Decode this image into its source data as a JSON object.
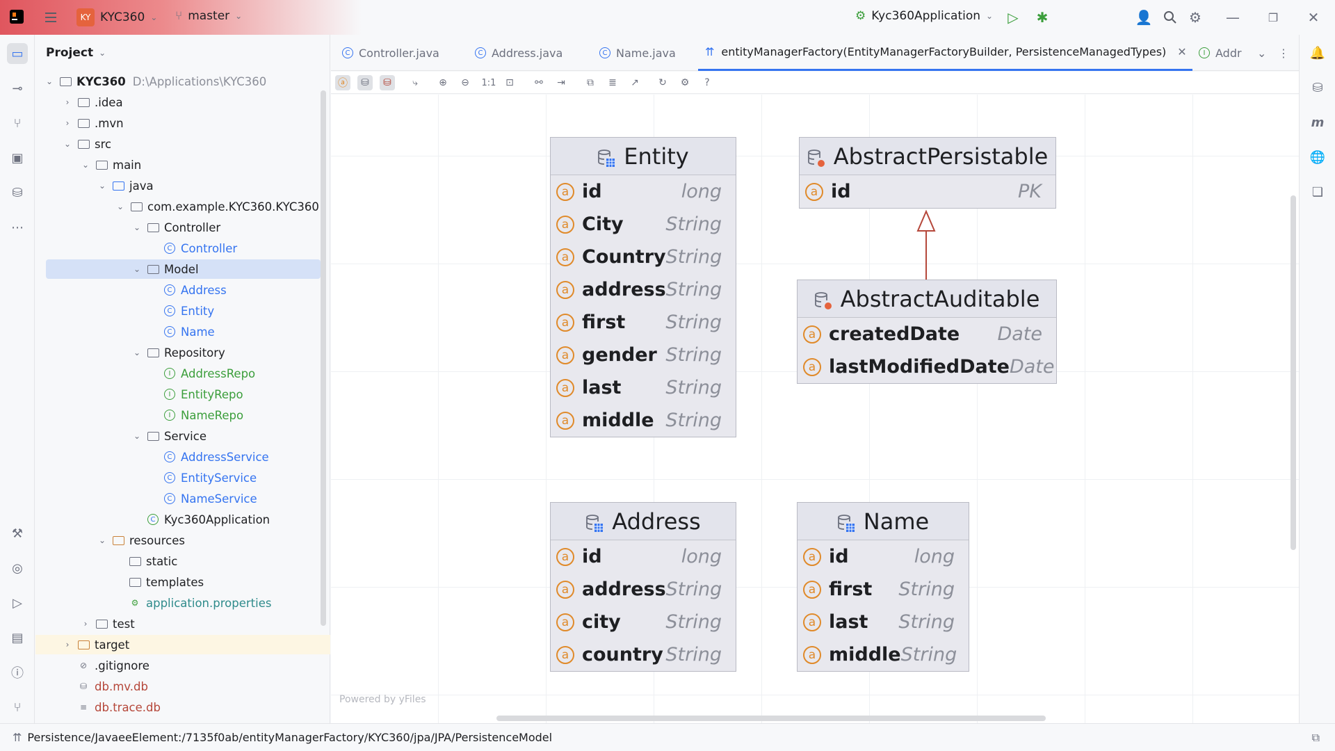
{
  "titlebar": {
    "project_badge": "KY",
    "project_name": "KYC360",
    "branch": "master",
    "run_config": "Kyc360Application"
  },
  "project_panel": {
    "title": "Project",
    "root_name": "KYC360",
    "root_path": "D:\\Applications\\KYC360",
    "items": [
      {
        "label": "KYC360"
      },
      {
        "label": ".idea"
      },
      {
        "label": ".mvn"
      },
      {
        "label": "src"
      },
      {
        "label": "main"
      },
      {
        "label": "java"
      },
      {
        "label": "com.example.KYC360.KYC360"
      },
      {
        "label": "Controller"
      },
      {
        "label": "Controller"
      },
      {
        "label": "Model"
      },
      {
        "label": "Address"
      },
      {
        "label": "Entity"
      },
      {
        "label": "Name"
      },
      {
        "label": "Repository"
      },
      {
        "label": "AddressRepo"
      },
      {
        "label": "EntityRepo"
      },
      {
        "label": "NameRepo"
      },
      {
        "label": "Service"
      },
      {
        "label": "AddressService"
      },
      {
        "label": "EntityService"
      },
      {
        "label": "NameService"
      },
      {
        "label": "Kyc360Application"
      },
      {
        "label": "resources"
      },
      {
        "label": "static"
      },
      {
        "label": "templates"
      },
      {
        "label": "application.properties"
      },
      {
        "label": "test"
      },
      {
        "label": "target"
      },
      {
        "label": ".gitignore"
      },
      {
        "label": "db.mv.db"
      },
      {
        "label": "db.trace.db"
      }
    ]
  },
  "tabs": [
    {
      "label": "Controller.java"
    },
    {
      "label": "Address.java"
    },
    {
      "label": "Name.java"
    },
    {
      "label": "entityManagerFactory(EntityManagerFactoryBuilder, PersistenceManagedTypes)"
    },
    {
      "label": "Addr"
    }
  ],
  "toolbar": {
    "actual_size": "1:1",
    "help": "?"
  },
  "diagram": {
    "nodes": [
      {
        "name": "Entity",
        "attrs": [
          {
            "name": "id",
            "type": "long"
          },
          {
            "name": "City",
            "type": "String"
          },
          {
            "name": "Country",
            "type": "String"
          },
          {
            "name": "address",
            "type": "String"
          },
          {
            "name": "first",
            "type": "String"
          },
          {
            "name": "gender",
            "type": "String"
          },
          {
            "name": "last",
            "type": "String"
          },
          {
            "name": "middle",
            "type": "String"
          }
        ]
      },
      {
        "name": "AbstractPersistable",
        "attrs": [
          {
            "name": "id",
            "type": "PK"
          }
        ]
      },
      {
        "name": "AbstractAuditable",
        "attrs": [
          {
            "name": "createdDate",
            "type": "Date"
          },
          {
            "name": "lastModifiedDate",
            "type": "Date"
          }
        ]
      },
      {
        "name": "Address",
        "attrs": [
          {
            "name": "id",
            "type": "long"
          },
          {
            "name": "address",
            "type": "String"
          },
          {
            "name": "city",
            "type": "String"
          },
          {
            "name": "country",
            "type": "String"
          }
        ]
      },
      {
        "name": "Name",
        "attrs": [
          {
            "name": "id",
            "type": "long"
          },
          {
            "name": "first",
            "type": "String"
          },
          {
            "name": "last",
            "type": "String"
          },
          {
            "name": "middle",
            "type": "String"
          }
        ]
      }
    ],
    "powered_by": "Powered by yFiles",
    "edge_color": "#b5473a",
    "attr_icon_color": "#e08a2a"
  },
  "statusbar": {
    "path": "Persistence/JavaeeElement:/7135f0ab/entityManagerFactory/KYC360/jpa/JPA/PersistenceModel"
  }
}
